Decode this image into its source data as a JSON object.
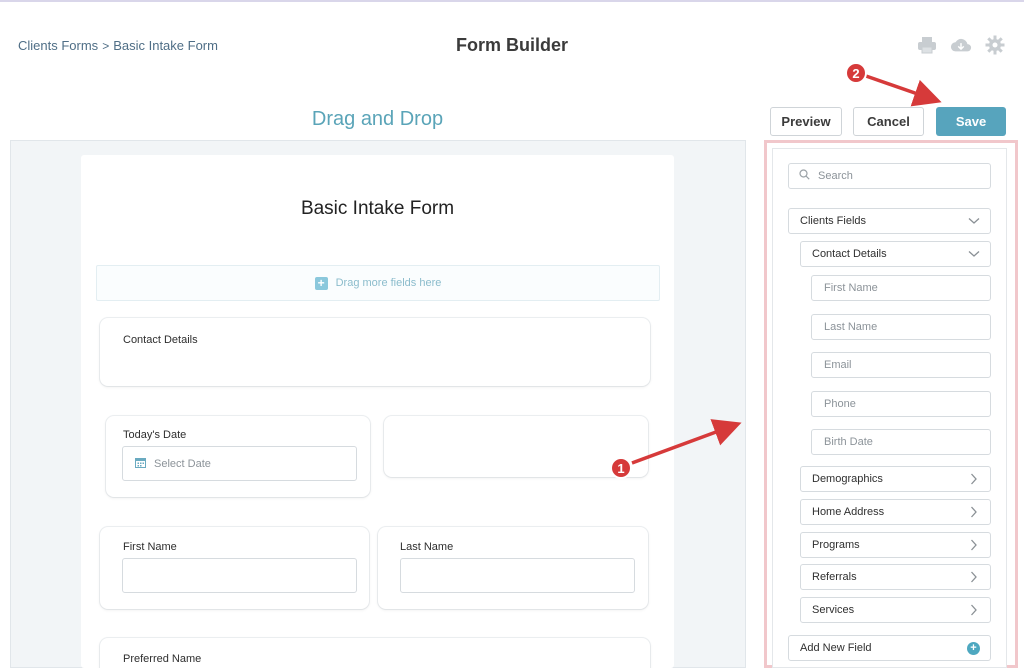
{
  "header": {
    "breadcrumb": [
      "Clients Forms",
      "Basic Intake Form"
    ],
    "breadcrumb_separator": ">",
    "title": "Form Builder",
    "icons": [
      "printer-icon",
      "cloud-download-icon",
      "gear-icon"
    ]
  },
  "canvas": {
    "heading": "Drag and Drop",
    "form_title": "Basic Intake Form",
    "dropzone_text": "Drag more fields here",
    "sections": {
      "contact_details_label": "Contact Details",
      "todays_date_label": "Today's Date",
      "date_placeholder": "Select Date",
      "first_name_label": "First Name",
      "last_name_label": "Last Name",
      "preferred_name_label": "Preferred Name"
    }
  },
  "toolbar": {
    "preview_label": "Preview",
    "cancel_label": "Cancel",
    "save_label": "Save"
  },
  "sidebar": {
    "search_placeholder": "Search",
    "clients_fields_label": "Clients Fields",
    "contact_details_label": "Contact Details",
    "contact_fields": [
      "First Name",
      "Last Name",
      "Email",
      "Phone",
      "Birth Date"
    ],
    "groups": [
      "Demographics",
      "Home Address",
      "Programs",
      "Referrals",
      "Services"
    ],
    "add_field_label": "Add New Field"
  },
  "annotations": {
    "badge_1": "1",
    "badge_2": "2"
  },
  "colors": {
    "accent": "#57a4bd",
    "annotation_red": "#d63a3a",
    "highlight_outline": "#f1c7cb"
  }
}
